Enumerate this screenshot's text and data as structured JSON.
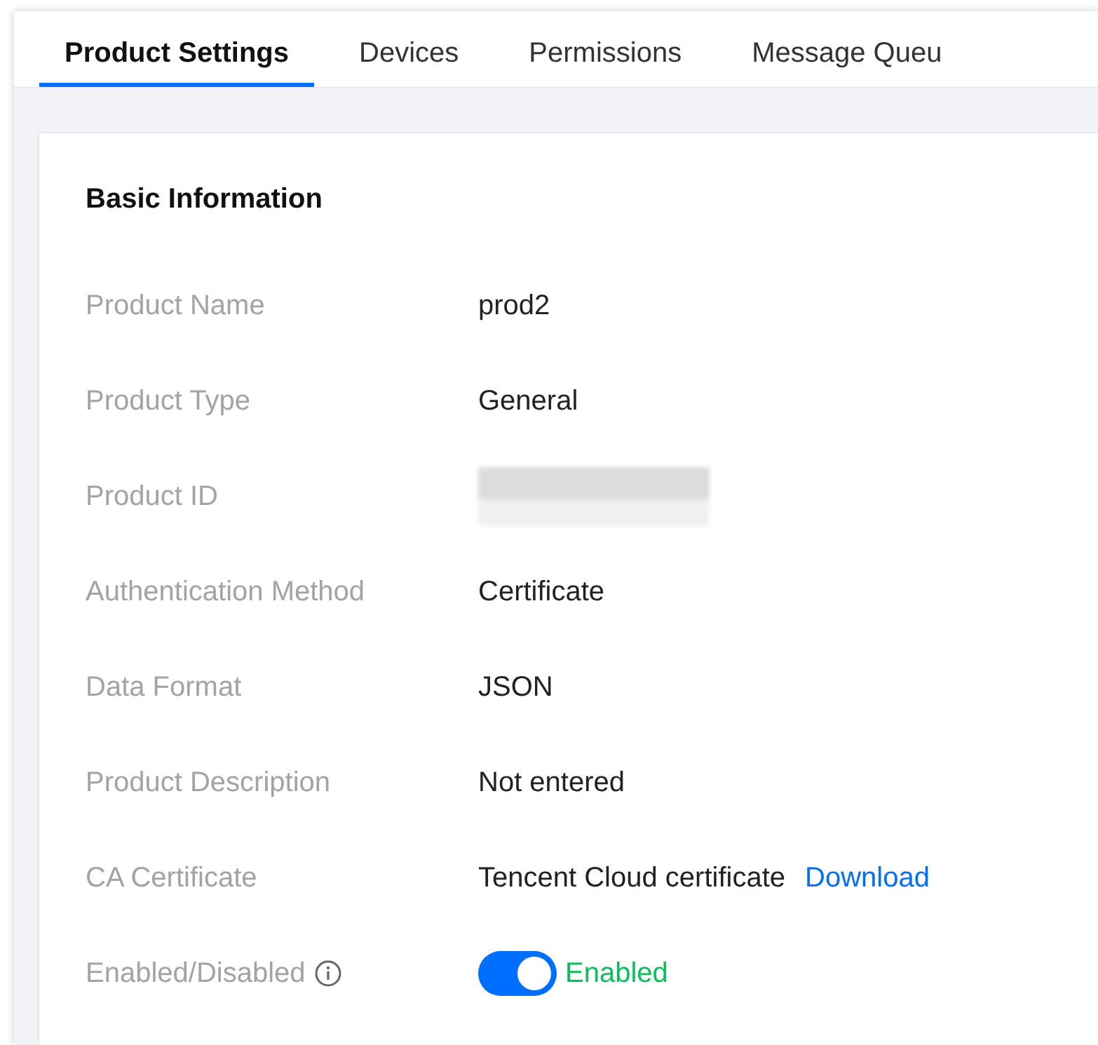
{
  "tabs": [
    {
      "label": "Product Settings",
      "selected": true
    },
    {
      "label": "Devices",
      "selected": false
    },
    {
      "label": "Permissions",
      "selected": false
    },
    {
      "label": "Message Queu",
      "selected": false
    }
  ],
  "section": {
    "title": "Basic Information",
    "rows": [
      {
        "label": "Product Name",
        "kind": "text",
        "value": "prod2"
      },
      {
        "label": "Product Type",
        "kind": "text",
        "value": "General"
      },
      {
        "label": "Product ID",
        "kind": "redacted"
      },
      {
        "label": "Authentication Method",
        "kind": "text",
        "value": "Certificate"
      },
      {
        "label": "Data Format",
        "kind": "text",
        "value": "JSON"
      },
      {
        "label": "Product Description",
        "kind": "text",
        "value": "Not entered"
      },
      {
        "label": "CA Certificate",
        "kind": "link",
        "value": "Tencent Cloud certificate",
        "link": "Download"
      },
      {
        "label": "Enabled/Disabled",
        "kind": "toggle",
        "info": true,
        "on": true,
        "value": "Enabled"
      }
    ]
  }
}
